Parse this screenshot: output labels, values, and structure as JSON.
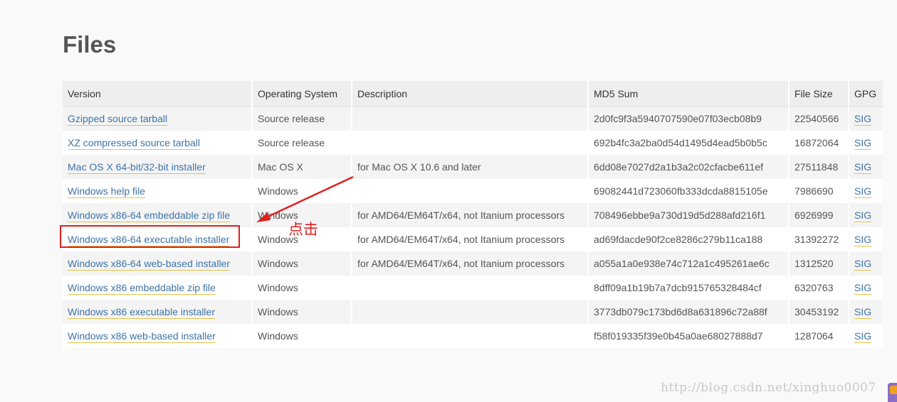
{
  "section": {
    "title": "Files"
  },
  "table": {
    "headers": [
      "Version",
      "Operating System",
      "Description",
      "MD5 Sum",
      "File Size",
      "GPG"
    ],
    "rows": [
      {
        "version": "Gzipped source tarball",
        "os": "Source release",
        "description": "",
        "md5": "2d0fc9f3a5940707590e07f03ecb08b9",
        "size": "22540566",
        "gpg": "SIG"
      },
      {
        "version": "XZ compressed source tarball",
        "os": "Source release",
        "description": "",
        "md5": "692b4fc3a2ba0d54d1495d4ead5b0b5c",
        "size": "16872064",
        "gpg": "SIG"
      },
      {
        "version": "Mac OS X 64-bit/32-bit installer",
        "os": "Mac OS X",
        "description": "for Mac OS X 10.6 and later",
        "md5": "6dd08e7027d2a1b3a2c02cfacbe611ef",
        "size": "27511848",
        "gpg": "SIG"
      },
      {
        "version": "Windows help file",
        "os": "Windows",
        "description": "",
        "md5": "69082441d723060fb333dcda8815105e",
        "size": "7986690",
        "gpg": "SIG"
      },
      {
        "version": "Windows x86-64 embeddable zip file",
        "os": "Windows",
        "description": "for AMD64/EM64T/x64, not Itanium processors",
        "md5": "708496ebbe9a730d19d5d288afd216f1",
        "size": "6926999",
        "gpg": "SIG"
      },
      {
        "version": "Windows x86-64 executable installer",
        "os": "Windows",
        "description": "for AMD64/EM64T/x64, not Itanium processors",
        "md5": "ad69fdacde90f2ce8286c279b11ca188",
        "size": "31392272",
        "gpg": "SIG"
      },
      {
        "version": "Windows x86-64 web-based installer",
        "os": "Windows",
        "description": "for AMD64/EM64T/x64, not Itanium processors",
        "md5": "a055a1a0e938e74c712a1c495261ae6c",
        "size": "1312520",
        "gpg": "SIG"
      },
      {
        "version": "Windows x86 embeddable zip file",
        "os": "Windows",
        "description": "",
        "md5": "8dff09a1b19b7a7dcb915765328484cf",
        "size": "6320763",
        "gpg": "SIG"
      },
      {
        "version": "Windows x86 executable installer",
        "os": "Windows",
        "description": "",
        "md5": "3773db079c173bd6d8a631896c72a88f",
        "size": "30453192",
        "gpg": "SIG"
      },
      {
        "version": "Windows x86 web-based installer",
        "os": "Windows",
        "description": "",
        "md5": "f58f019335f39e0b45a0ae68027888d7",
        "size": "1287064",
        "gpg": "SIG"
      }
    ]
  },
  "annotation": {
    "text": "点击",
    "color": "#e0201f"
  },
  "watermark": {
    "text": "http://blog.csdn.net/xinghuo0007"
  },
  "colors": {
    "link": "#3f73a7",
    "link_underline": "#e2c24a",
    "header_bg": "#eeeeee",
    "stripe_bg": "#f4f4f4"
  },
  "icons": {
    "corner_badge": "corner-badge-icon",
    "arrow": "annotation-arrow-icon"
  }
}
